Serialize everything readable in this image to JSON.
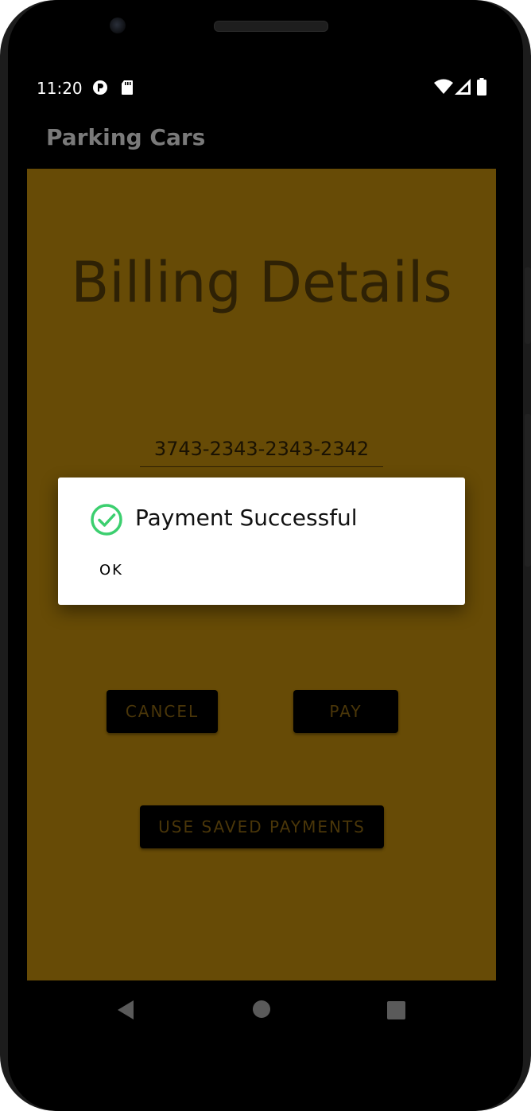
{
  "status_bar": {
    "time": "11:20",
    "icons": [
      "screen-record-icon",
      "sd-card-icon",
      "wifi-icon",
      "cell-signal-icon",
      "battery-icon"
    ]
  },
  "app_bar": {
    "title": "Parking Cars"
  },
  "main": {
    "heading": "Billing Details",
    "card_number": "3743-2343-2343-2342",
    "cancel_label": "CANCEL",
    "pay_label": "PAY",
    "saved_payments_label": "USE SAVED PAYMENTS"
  },
  "dialog": {
    "icon": "check-circle-icon",
    "message": "Payment Successful",
    "ok_label": "OK"
  },
  "nav_bar": {
    "icons": [
      "back-icon",
      "home-icon",
      "recents-icon"
    ]
  },
  "colors": {
    "content_background": "#674b06",
    "success_green": "#3ccf6f",
    "dialog_background": "#ffffff"
  }
}
